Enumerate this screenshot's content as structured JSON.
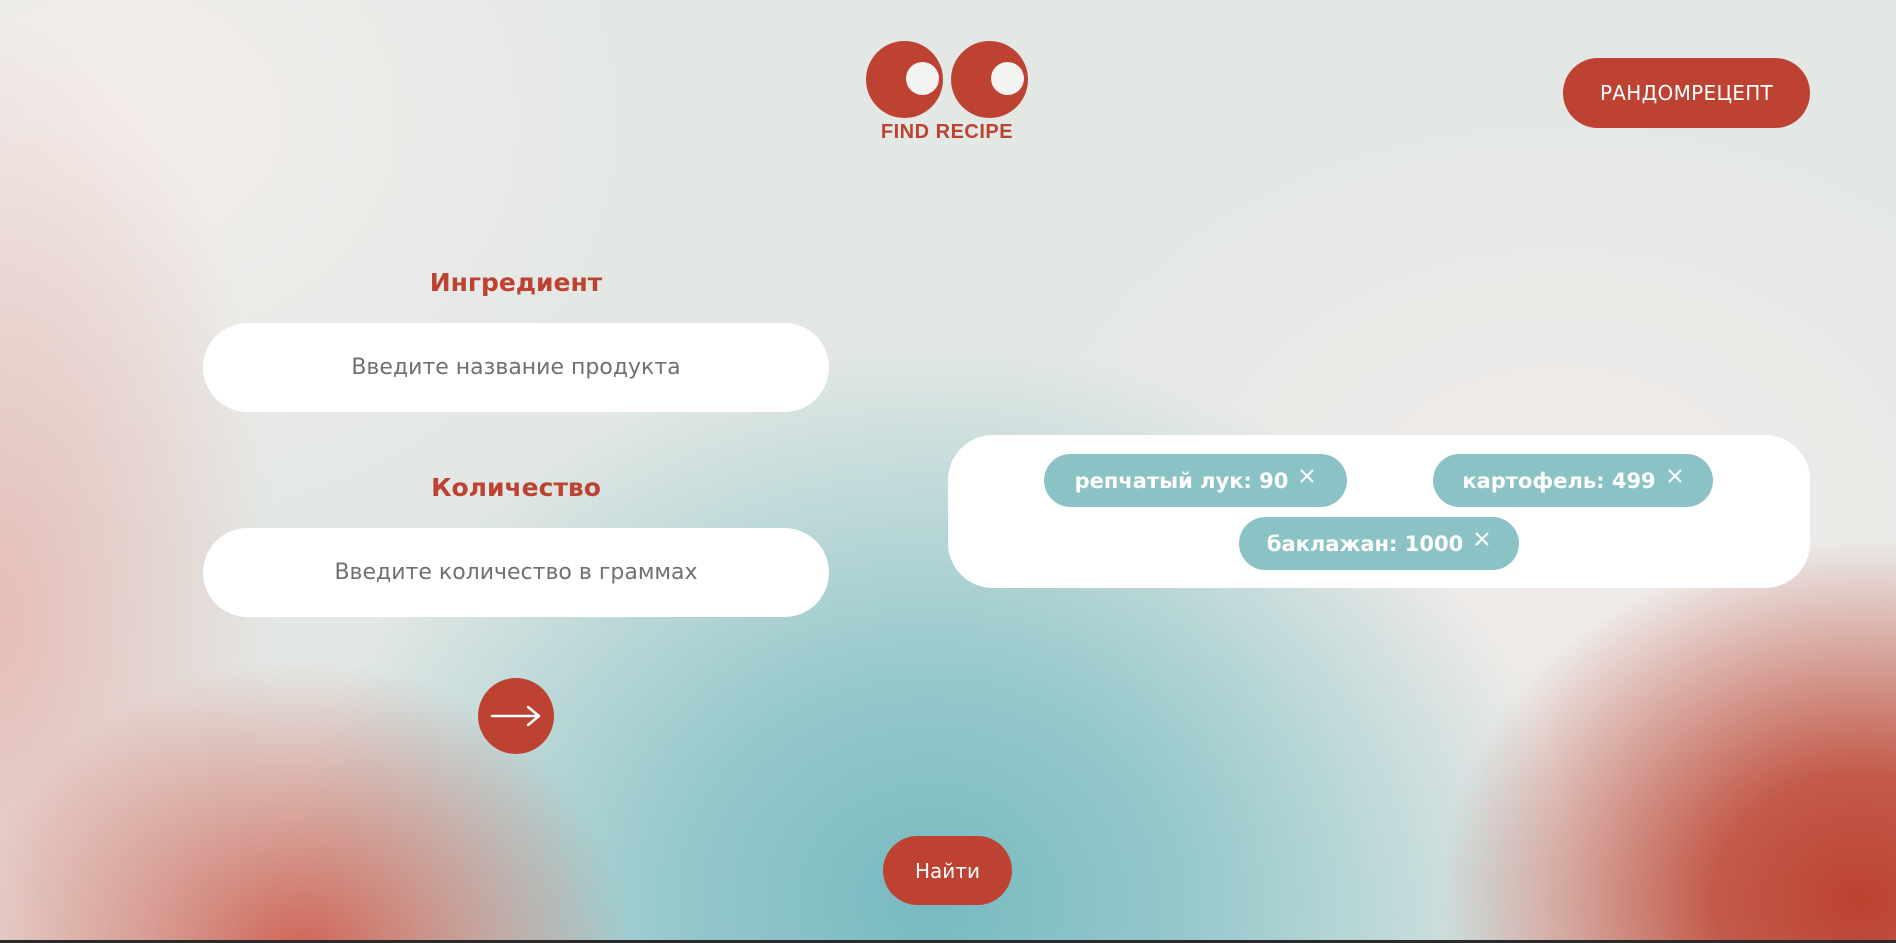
{
  "logo": {
    "text": "FIND RECIPE",
    "color": "#bd4232"
  },
  "header": {
    "random_button_label": "РАНДОМРЕЦЕПТ"
  },
  "form": {
    "ingredient_label": "Ингредиент",
    "ingredient_placeholder": "Введите название продукта",
    "ingredient_value": "",
    "quantity_label": "Количество",
    "quantity_placeholder": "Введите количество в граммах",
    "quantity_value": "",
    "add_button_icon": "arrow-right-icon"
  },
  "tags": [
    {
      "label": "репчатый лук: 90",
      "remove_icon": "close-icon"
    },
    {
      "label": "картофель: 499",
      "remove_icon": "close-icon"
    },
    {
      "label": "баклажан: 1000",
      "remove_icon": "close-icon"
    }
  ],
  "search_button_label": "Найти",
  "colors": {
    "accent": "#bd4232",
    "tag": "#8bc2c6",
    "surface": "#ffffff"
  }
}
